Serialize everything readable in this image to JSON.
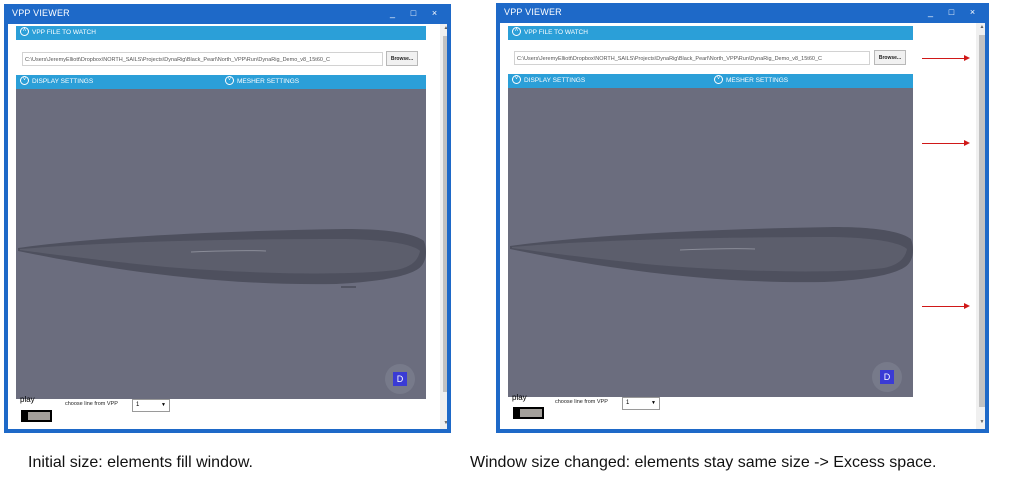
{
  "window": {
    "title": "VPP VIEWER",
    "controls": {
      "minimize": "_",
      "maximize": "□",
      "close": "×"
    }
  },
  "vpp_file": {
    "header": "VPP FILE TO WATCH",
    "header_icon": "chevron-up-icon",
    "path": "C:\\Users\\JeremyElliott\\Dropbox\\NORTH_SAILS\\Projects\\DynaRig\\Black_Pearl\\North_VPP\\Run\\DynaRig_Demo_v8_15t60_C",
    "browse_label": "Browse..."
  },
  "settings": {
    "display_label": "DISPLAY SETTINGS",
    "mesher_label": "MESHER SETTINGS",
    "icon": "chevron-down-icon"
  },
  "viewport": {
    "logo_letter": "D"
  },
  "controls": {
    "play_label": "play",
    "line_label": "choose line from VPP",
    "line_value": "1",
    "dropdown_caret": "▼"
  },
  "captions": {
    "left": "Initial size: elements fill window.",
    "right": "Window size changed: elements stay same size -> Excess space."
  },
  "colors": {
    "window_frame": "#1e69c8",
    "header_blue": "#2b9fd8",
    "viewport_bg": "#6b6d7e",
    "hull": "#5a5c6a",
    "arrow_red": "#d01818"
  }
}
